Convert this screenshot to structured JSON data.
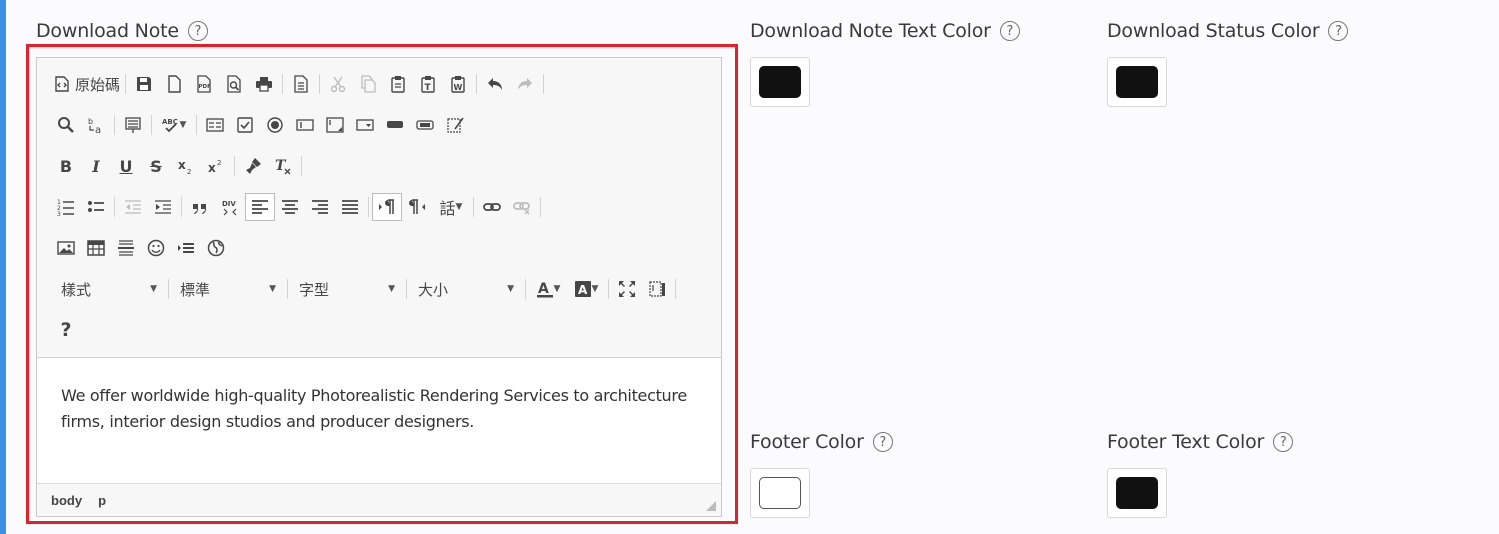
{
  "labels": {
    "download_note": "Download Note",
    "download_note_text_color": "Download Note Text Color",
    "download_status_color": "Download Status Color",
    "footer_color": "Footer Color",
    "footer_text_color": "Footer Text Color",
    "help": "?"
  },
  "colors": {
    "download_note_text_color": "#111111",
    "download_status_color": "#111111",
    "footer_color": "#ffffff",
    "footer_text_color": "#111111",
    "highlight": "#e3202b",
    "accent": "#3d8fe6"
  },
  "editor": {
    "toolbar": {
      "source_label": "原始碼",
      "styles_combo": "樣式",
      "format_combo": "標準",
      "font_combo": "字型",
      "size_combo": "大小",
      "language_label": "話",
      "bold": "B",
      "italic": "I",
      "underline": "U",
      "strike": "S",
      "help": "?"
    },
    "content": "We offer worldwide high-quality Photorealistic Rendering Services to architecture firms, interior design studios and producer designers.",
    "path": [
      "body",
      "p"
    ]
  }
}
